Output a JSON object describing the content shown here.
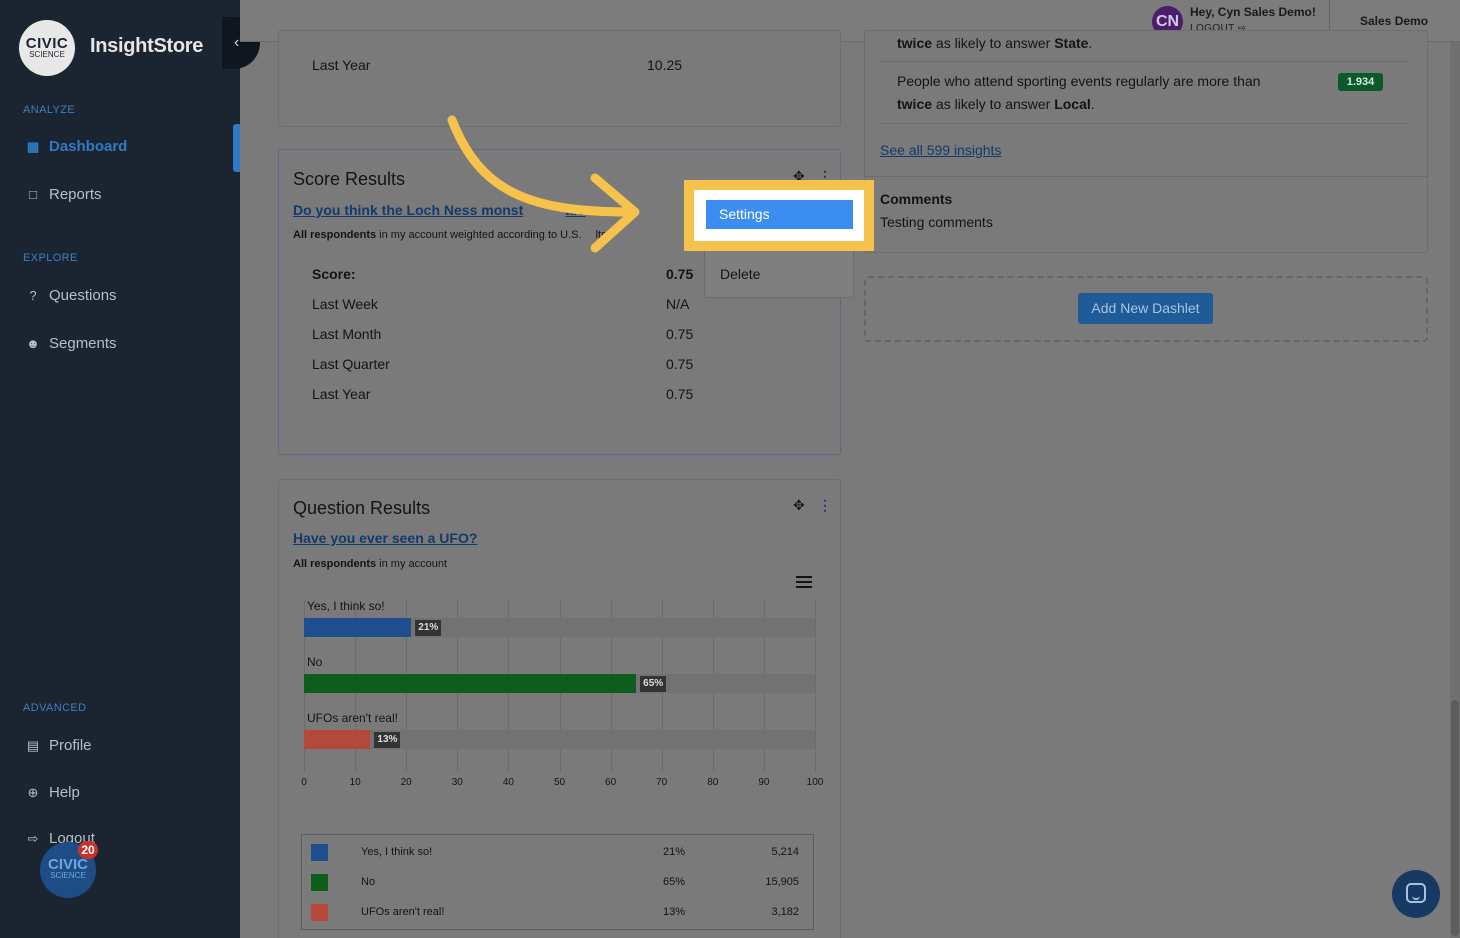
{
  "sidebar": {
    "logo_line1": "CIVIC",
    "logo_line2": "SCIENCE",
    "brand": "InsightStore",
    "sections": {
      "analyze": "ANALYZE",
      "explore": "EXPLORE",
      "advanced": "ADVANCED"
    },
    "items": {
      "dashboard": "Dashboard",
      "reports": "Reports",
      "questions": "Questions",
      "segments": "Segments",
      "profile": "Profile",
      "help": "Help",
      "logout": "Logout"
    },
    "badge_count": "20"
  },
  "topbar": {
    "avatar_initials": "CN",
    "greeting": "Hey, Cyn Sales Demo!",
    "logout": "LOGOUT",
    "account": "Sales Demo"
  },
  "top_card": {
    "row_label": "Last Year",
    "row_value": "10.25"
  },
  "score_card": {
    "title": "Score Results",
    "question": "Do you think the Loch Ness monst",
    "question_tail": "al?",
    "sub_bold": "All respondents",
    "sub_rest": " in my account weighted according to U.S.",
    "sub_tail": "lts",
    "rows": [
      {
        "label": "Score:",
        "value": "0.75"
      },
      {
        "label": "Last Week",
        "value": "N/A"
      },
      {
        "label": "Last Month",
        "value": "0.75"
      },
      {
        "label": "Last Quarter",
        "value": "0.75"
      },
      {
        "label": "Last Year",
        "value": "0.75"
      }
    ]
  },
  "menu": {
    "settings": "Settings",
    "delete": "Delete"
  },
  "question_card": {
    "title": "Question Results",
    "question": "Have you ever seen a UFO?",
    "sub_bold": "All respondents",
    "sub_rest": " in my account"
  },
  "chart_data": {
    "type": "bar",
    "orientation": "horizontal",
    "categories": [
      "Yes, I think so!",
      "No",
      "UFOs aren't real!"
    ],
    "values": [
      21,
      65,
      13
    ],
    "value_labels": [
      "21%",
      "65%",
      "13%"
    ],
    "colors": [
      "#1f4e8f",
      "#0d5d1c",
      "#b3483b"
    ],
    "xlim": [
      0,
      100
    ],
    "ticks": [
      "0",
      "10",
      "20",
      "30",
      "40",
      "50",
      "60",
      "70",
      "80",
      "90",
      "100"
    ],
    "table": [
      {
        "name": "Yes, I think so!",
        "pct": "21%",
        "count": "5,214"
      },
      {
        "name": "No",
        "pct": "65%",
        "count": "15,905"
      },
      {
        "name": "UFOs aren't real!",
        "pct": "13%",
        "count": "3,182"
      }
    ]
  },
  "insights": {
    "item1_tail_pre": "twice",
    "item1_tail_mid": " as likely to answer ",
    "item1_tail_bold": "State",
    "item1_tail_end": ".",
    "item2_line1": "People who attend sporting events regularly are more than",
    "item2_b1": "twice",
    "item2_mid": " as likely to answer ",
    "item2_b2": "Local",
    "item2_end": ".",
    "item2_score": "1.934",
    "see_all": "See all 599 insights"
  },
  "comments": {
    "title": "Comments",
    "text": "Testing comments"
  },
  "add_dashlet": "Add New Dashlet"
}
